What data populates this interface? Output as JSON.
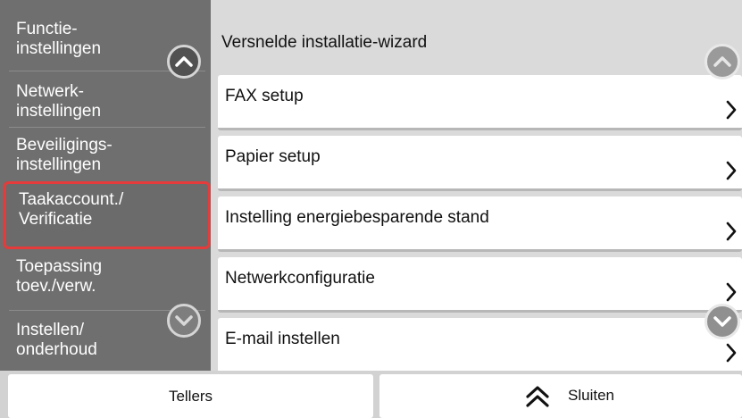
{
  "sidebar": {
    "items": [
      {
        "label": "Functie-\ninstellingen"
      },
      {
        "label": "Netwerk-\ninstellingen"
      },
      {
        "label": "Beveiligings-\ninstellingen"
      },
      {
        "label": "Taakaccount./\nVerificatie",
        "selected": true
      },
      {
        "label": "Toepassing\ntoev./verw."
      },
      {
        "label": "Instellen/\nonderhoud"
      }
    ],
    "scroll_up_icon": "chevron-up-icon",
    "scroll_down_icon": "chevron-down-icon"
  },
  "main": {
    "header": "Versnelde installatie-wizard",
    "rows": [
      {
        "label": "FAX setup"
      },
      {
        "label": "Papier setup"
      },
      {
        "label": "Instelling energiebesparende stand"
      },
      {
        "label": "Netwerkconfiguratie"
      },
      {
        "label": "E-mail instellen"
      }
    ]
  },
  "bottom": {
    "tellers_label": "Tellers",
    "sluiten_label": "Sluiten",
    "sluiten_icon": "double-chevron-up-icon"
  },
  "colors": {
    "sidebar_bg": "#6e6f6e",
    "selection_border": "#e53b3b",
    "main_bg": "#dadada"
  }
}
